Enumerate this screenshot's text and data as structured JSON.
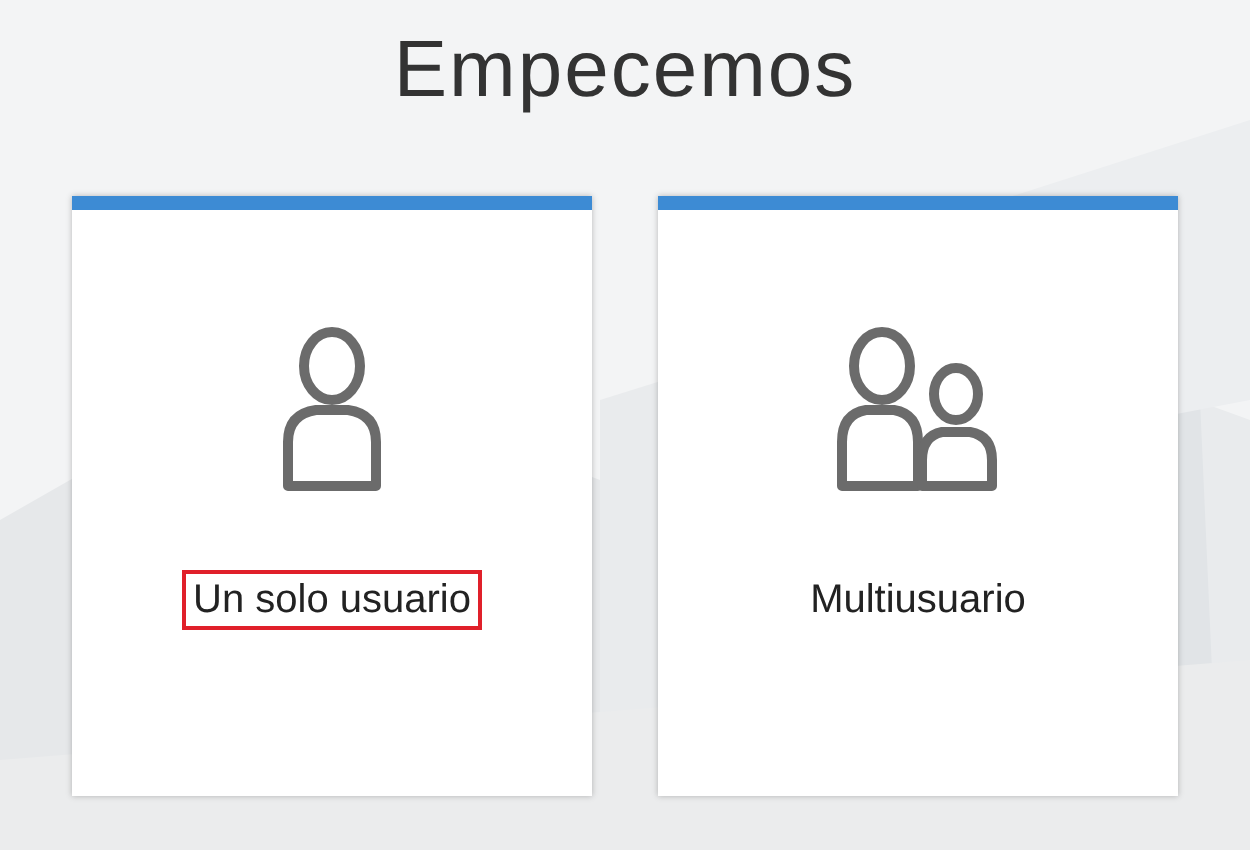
{
  "title": "Empecemos",
  "cards": [
    {
      "label": "Un solo usuario",
      "kind": "single",
      "selected": true
    },
    {
      "label": "Multiusuario",
      "kind": "multi",
      "selected": false
    }
  ]
}
